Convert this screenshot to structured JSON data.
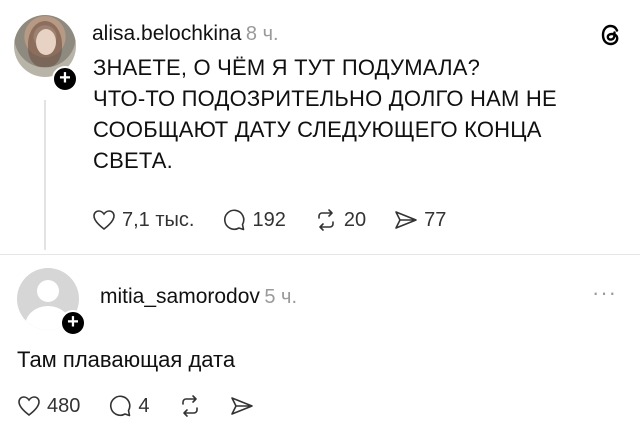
{
  "post": {
    "username": "alisa.belochkina",
    "time": "8 ч.",
    "text_lines": [
      "ЗНАЕТЕ, О ЧЁМ Я ТУТ ПОДУМАЛА?",
      "ЧТО-ТО ПОДОЗРИТЕЛЬНО ДОЛГО НАМ НЕ",
      "СООБЩАЮТ ДАТУ СЛЕДУЮЩЕГО КОНЦА",
      "СВЕТА."
    ],
    "likes": "7,1 тыс.",
    "comments": "192",
    "reposts": "20",
    "shares": "77",
    "logo_icon": "threads-logo-icon"
  },
  "reply": {
    "username": "mitia_samorodov",
    "time": "5 ч.",
    "text": "Там плавающая дата",
    "likes": "480",
    "comments": "4",
    "more_label": "···"
  }
}
